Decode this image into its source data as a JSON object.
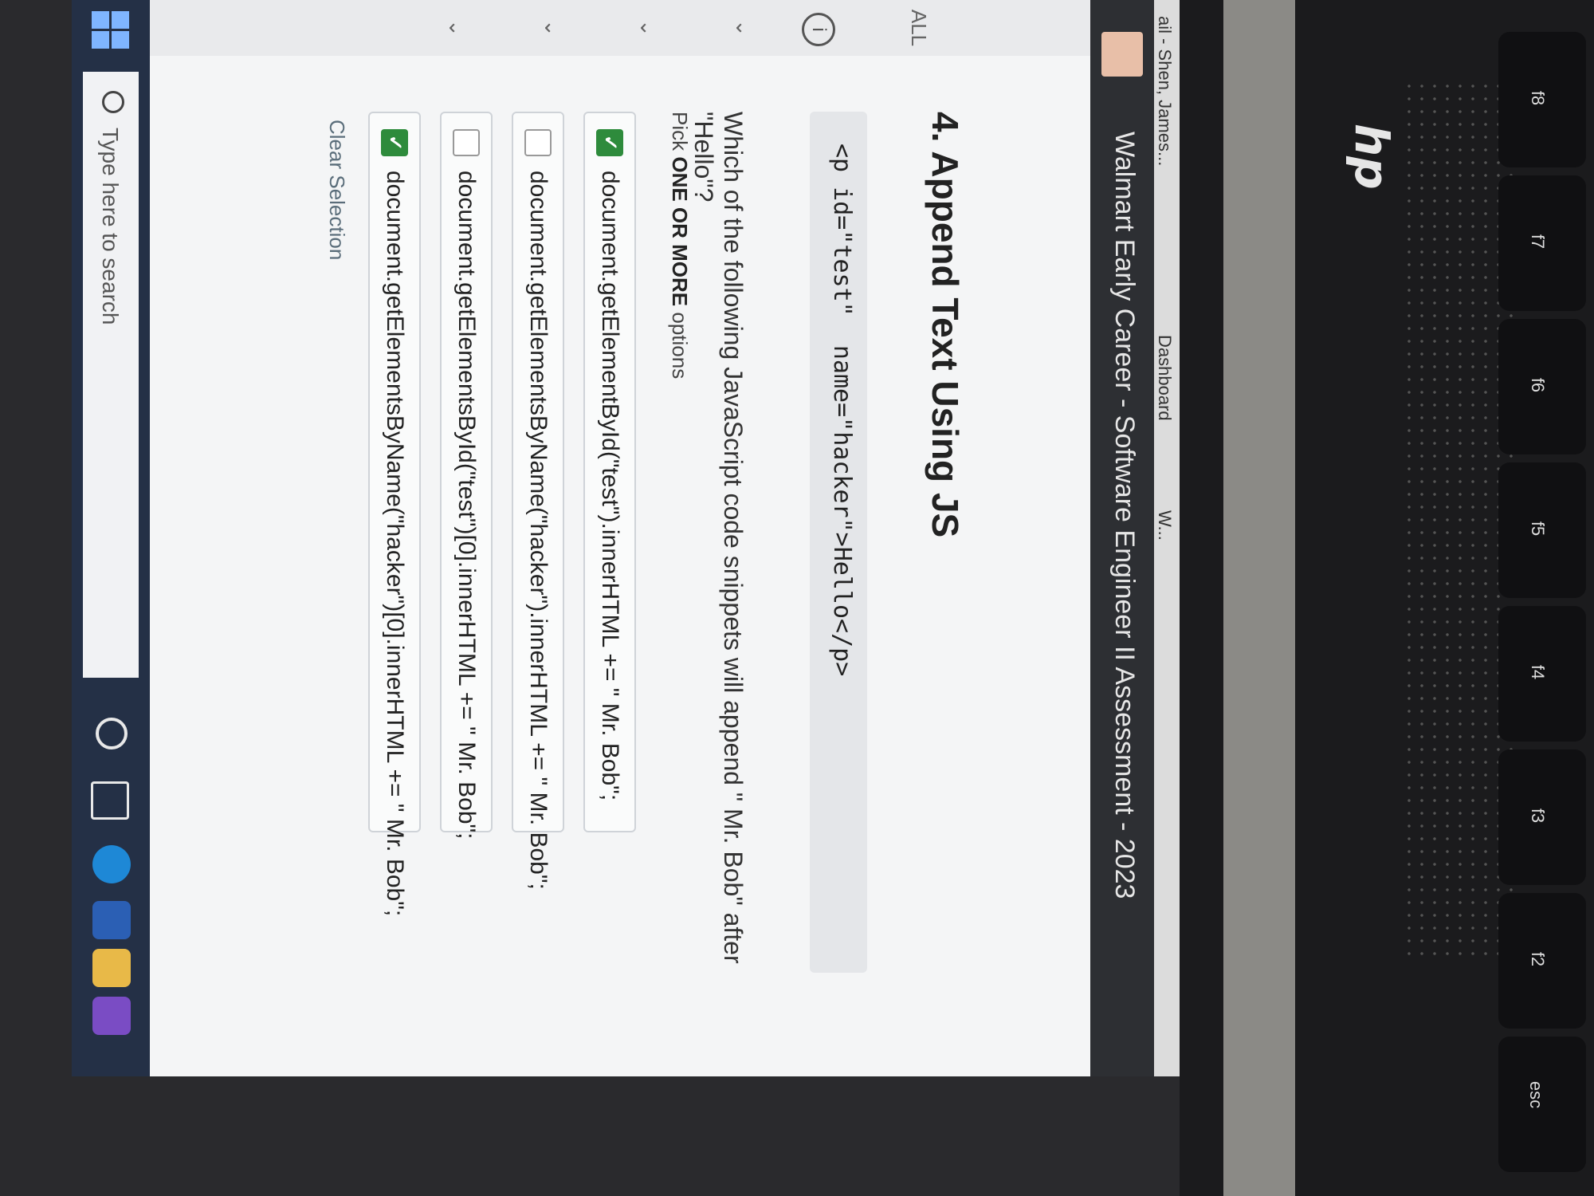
{
  "browser": {
    "tabs": [
      "ail - Shen, James...",
      "Dashboard",
      "W..."
    ]
  },
  "window": {
    "title": "Walmart Early Career - Software Engineer II Assessment - 2023"
  },
  "sidebar": {
    "items": [
      "ALL",
      "i"
    ]
  },
  "question": {
    "number_title": "4. Append Text Using JS",
    "code_snippet": "<p id=\"test\"  name=\"hacker\">Hello</p>",
    "prompt": "Which of the following JavaScript code snippets will append \" Mr. Bob\" after \"Hello\"?",
    "pick_prefix": "Pick ",
    "pick_bold": "ONE OR MORE",
    "pick_suffix": " options",
    "options": [
      {
        "label": "document.getElementById(\"test\").innerHTML += \" Mr. Bob\";",
        "checked": true
      },
      {
        "label": "document.getElementsByName(\"hacker\").innerHTML += \" Mr. Bob\";",
        "checked": false
      },
      {
        "label": "document.getElementsById(\"test\")[0].innerHTML += \" Mr. Bob\";",
        "checked": false
      },
      {
        "label": "document.getElementsByName(\"hacker\")[0].innerHTML += \" Mr. Bob\";",
        "checked": true
      }
    ],
    "clear_label": "Clear Selection"
  },
  "taskbar": {
    "search_placeholder": "Type here to search"
  },
  "hardware": {
    "brand": "hp",
    "keys": [
      "esc",
      "f2",
      "f3",
      "f4",
      "f5",
      "f6",
      "f7",
      "f8"
    ]
  },
  "colors": {
    "checked_green": "#2e8b3c",
    "title_bar": "#2d2f33",
    "taskbar": "#243046"
  }
}
